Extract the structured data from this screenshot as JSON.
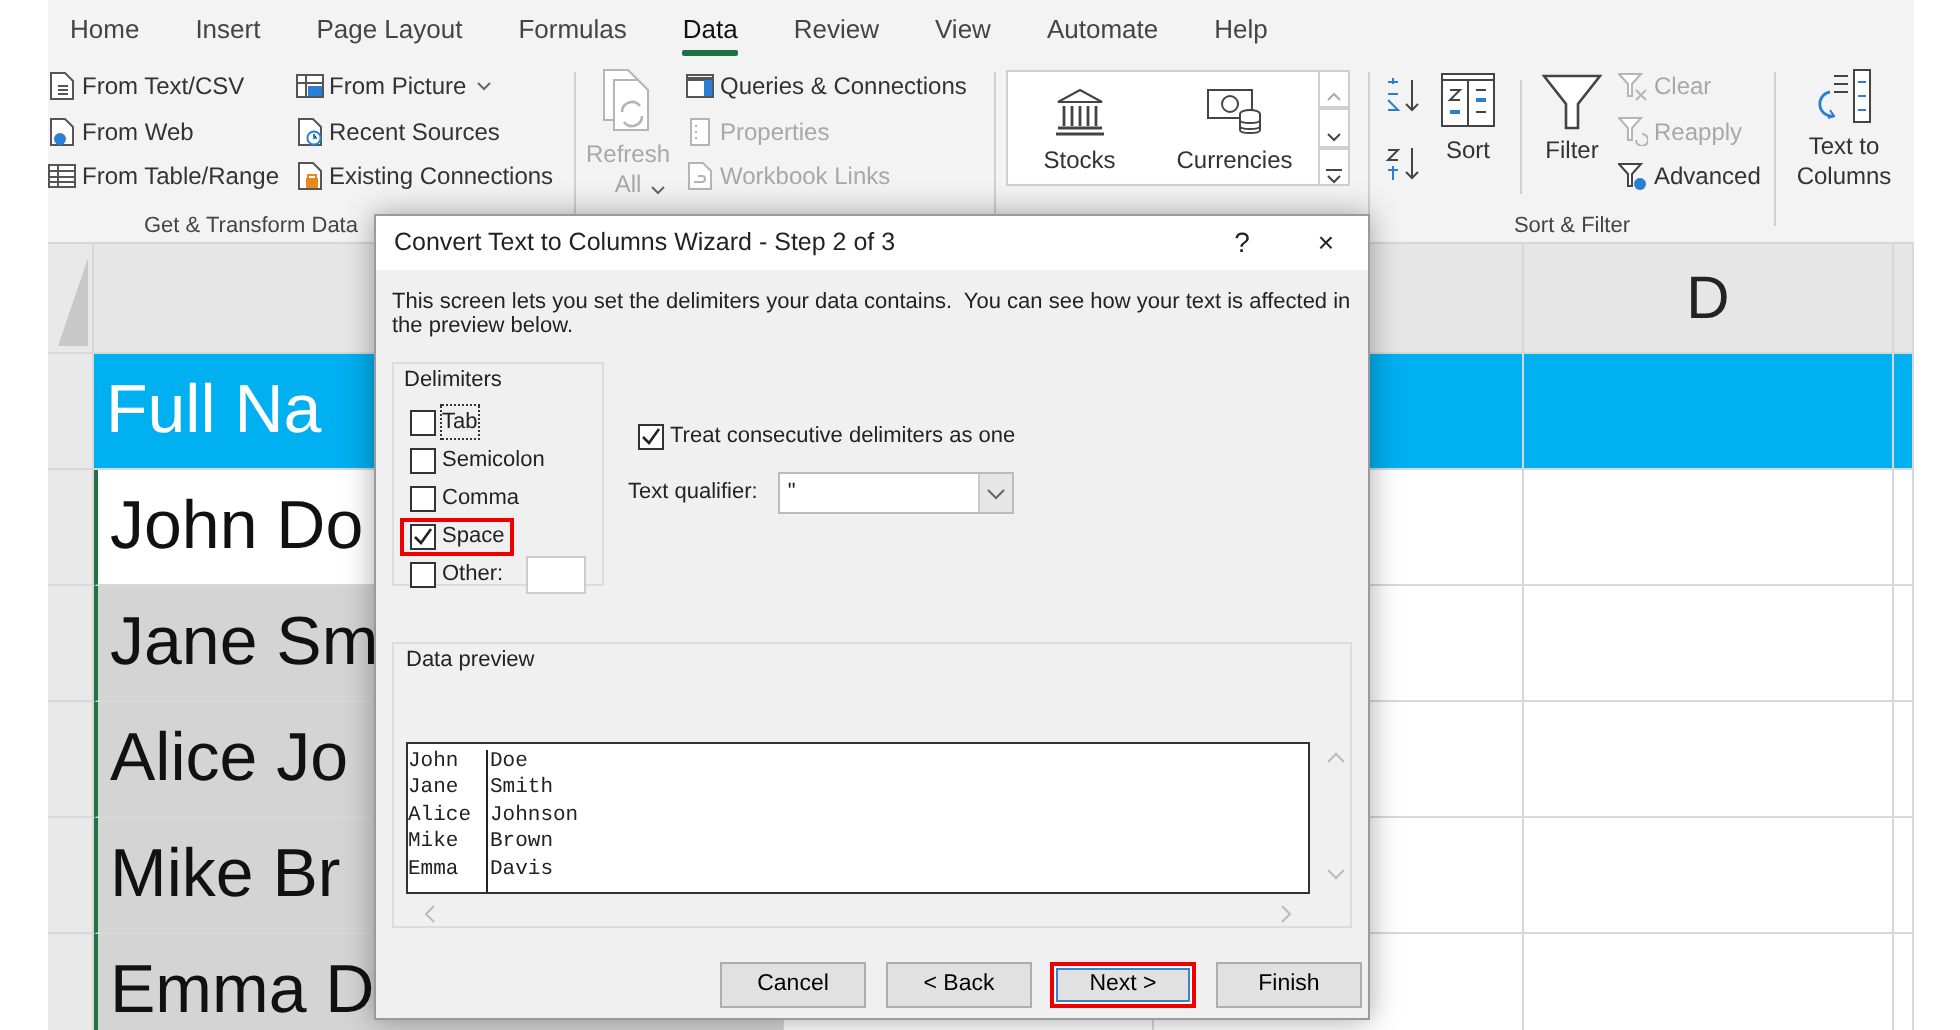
{
  "ribbon_tabs": [
    {
      "label": "Home",
      "selected": false
    },
    {
      "label": "Insert",
      "selected": false
    },
    {
      "label": "Page Layout",
      "selected": false
    },
    {
      "label": "Formulas",
      "selected": false
    },
    {
      "label": "Data",
      "selected": true
    },
    {
      "label": "Review",
      "selected": false
    },
    {
      "label": "View",
      "selected": false
    },
    {
      "label": "Automate",
      "selected": false
    },
    {
      "label": "Help",
      "selected": false
    }
  ],
  "get_transform_data": {
    "label": "Get & Transform Data",
    "columns": [
      [
        {
          "label": "From Text/CSV",
          "dropdown": false
        },
        {
          "label": "From Web",
          "dropdown": false
        },
        {
          "label": "From Table/Range",
          "dropdown": false
        }
      ],
      [
        {
          "label": "From Picture",
          "dropdown": true
        },
        {
          "label": "Recent Sources",
          "dropdown": false
        },
        {
          "label": "Existing Connections",
          "dropdown": false
        }
      ]
    ]
  },
  "queries_connections": {
    "refresh": {
      "label": "Refresh All",
      "disabled": true,
      "dropdown": true
    },
    "items": [
      {
        "label": "Queries & Connections",
        "disabled": false
      },
      {
        "label": "Properties",
        "disabled": true
      },
      {
        "label": "Workbook Links",
        "disabled": true
      }
    ]
  },
  "data_types": {
    "items": [
      {
        "label": "Stocks"
      },
      {
        "label": "Currencies"
      }
    ]
  },
  "sort_filter": {
    "label": "Sort & Filter",
    "sort": {
      "label": "Sort"
    },
    "filter": {
      "label": "Filter"
    },
    "filter_options": [
      {
        "label": "Clear",
        "disabled": true
      },
      {
        "label": "Reapply",
        "disabled": true
      },
      {
        "label": "Advanced",
        "disabled": false
      }
    ]
  },
  "text_to_columns": {
    "label": "Text to Columns"
  },
  "sheet": {
    "column_header": "D",
    "rows": [
      {
        "text": "Full Na",
        "kind": "header"
      },
      {
        "text": "John Do",
        "kind": "active"
      },
      {
        "text": "Jane Sm",
        "kind": "selected"
      },
      {
        "text": "Alice Jo",
        "kind": "selected"
      },
      {
        "text": "Mike Br",
        "kind": "selected"
      },
      {
        "text": "Emma D",
        "kind": "selected"
      }
    ]
  },
  "dialog": {
    "title": "Convert Text to Columns Wizard - Step 2 of 3",
    "help_button": "?",
    "close_button": "×",
    "description": "This screen lets you set the delimiters your data contains.  You can see how your text is affected in the preview below.",
    "delimiters": {
      "label": "Delimiters",
      "options": [
        {
          "label": "Tab",
          "kind": "checkbox",
          "checked": false,
          "focused": true,
          "highlighted": false
        },
        {
          "label": "Semicolon",
          "kind": "checkbox",
          "checked": false,
          "focused": false,
          "highlighted": false
        },
        {
          "label": "Comma",
          "kind": "checkbox",
          "checked": false,
          "focused": false,
          "highlighted": false
        },
        {
          "label": "Space",
          "kind": "checkbox",
          "checked": true,
          "focused": false,
          "highlighted": true
        },
        {
          "label": "Other:",
          "kind": "other",
          "checked": false,
          "focused": false,
          "highlighted": false
        }
      ]
    },
    "treat_consecutive": {
      "label": "Treat consecutive delimiters as one",
      "checked": true
    },
    "text_qualifier": {
      "label": "Text qualifier:",
      "value": "\""
    },
    "preview": {
      "label": "Data preview",
      "rows": [
        [
          "John",
          "Doe"
        ],
        [
          "Jane",
          "Smith"
        ],
        [
          "Alice",
          "Johnson"
        ],
        [
          "Mike",
          "Brown"
        ],
        [
          "Emma",
          "Davis"
        ]
      ]
    },
    "buttons": [
      {
        "label": "Cancel",
        "highlighted": false
      },
      {
        "label": "< Back",
        "highlighted": false
      },
      {
        "label": "Next >",
        "highlighted": true
      },
      {
        "label": "Finish",
        "highlighted": false
      }
    ]
  }
}
